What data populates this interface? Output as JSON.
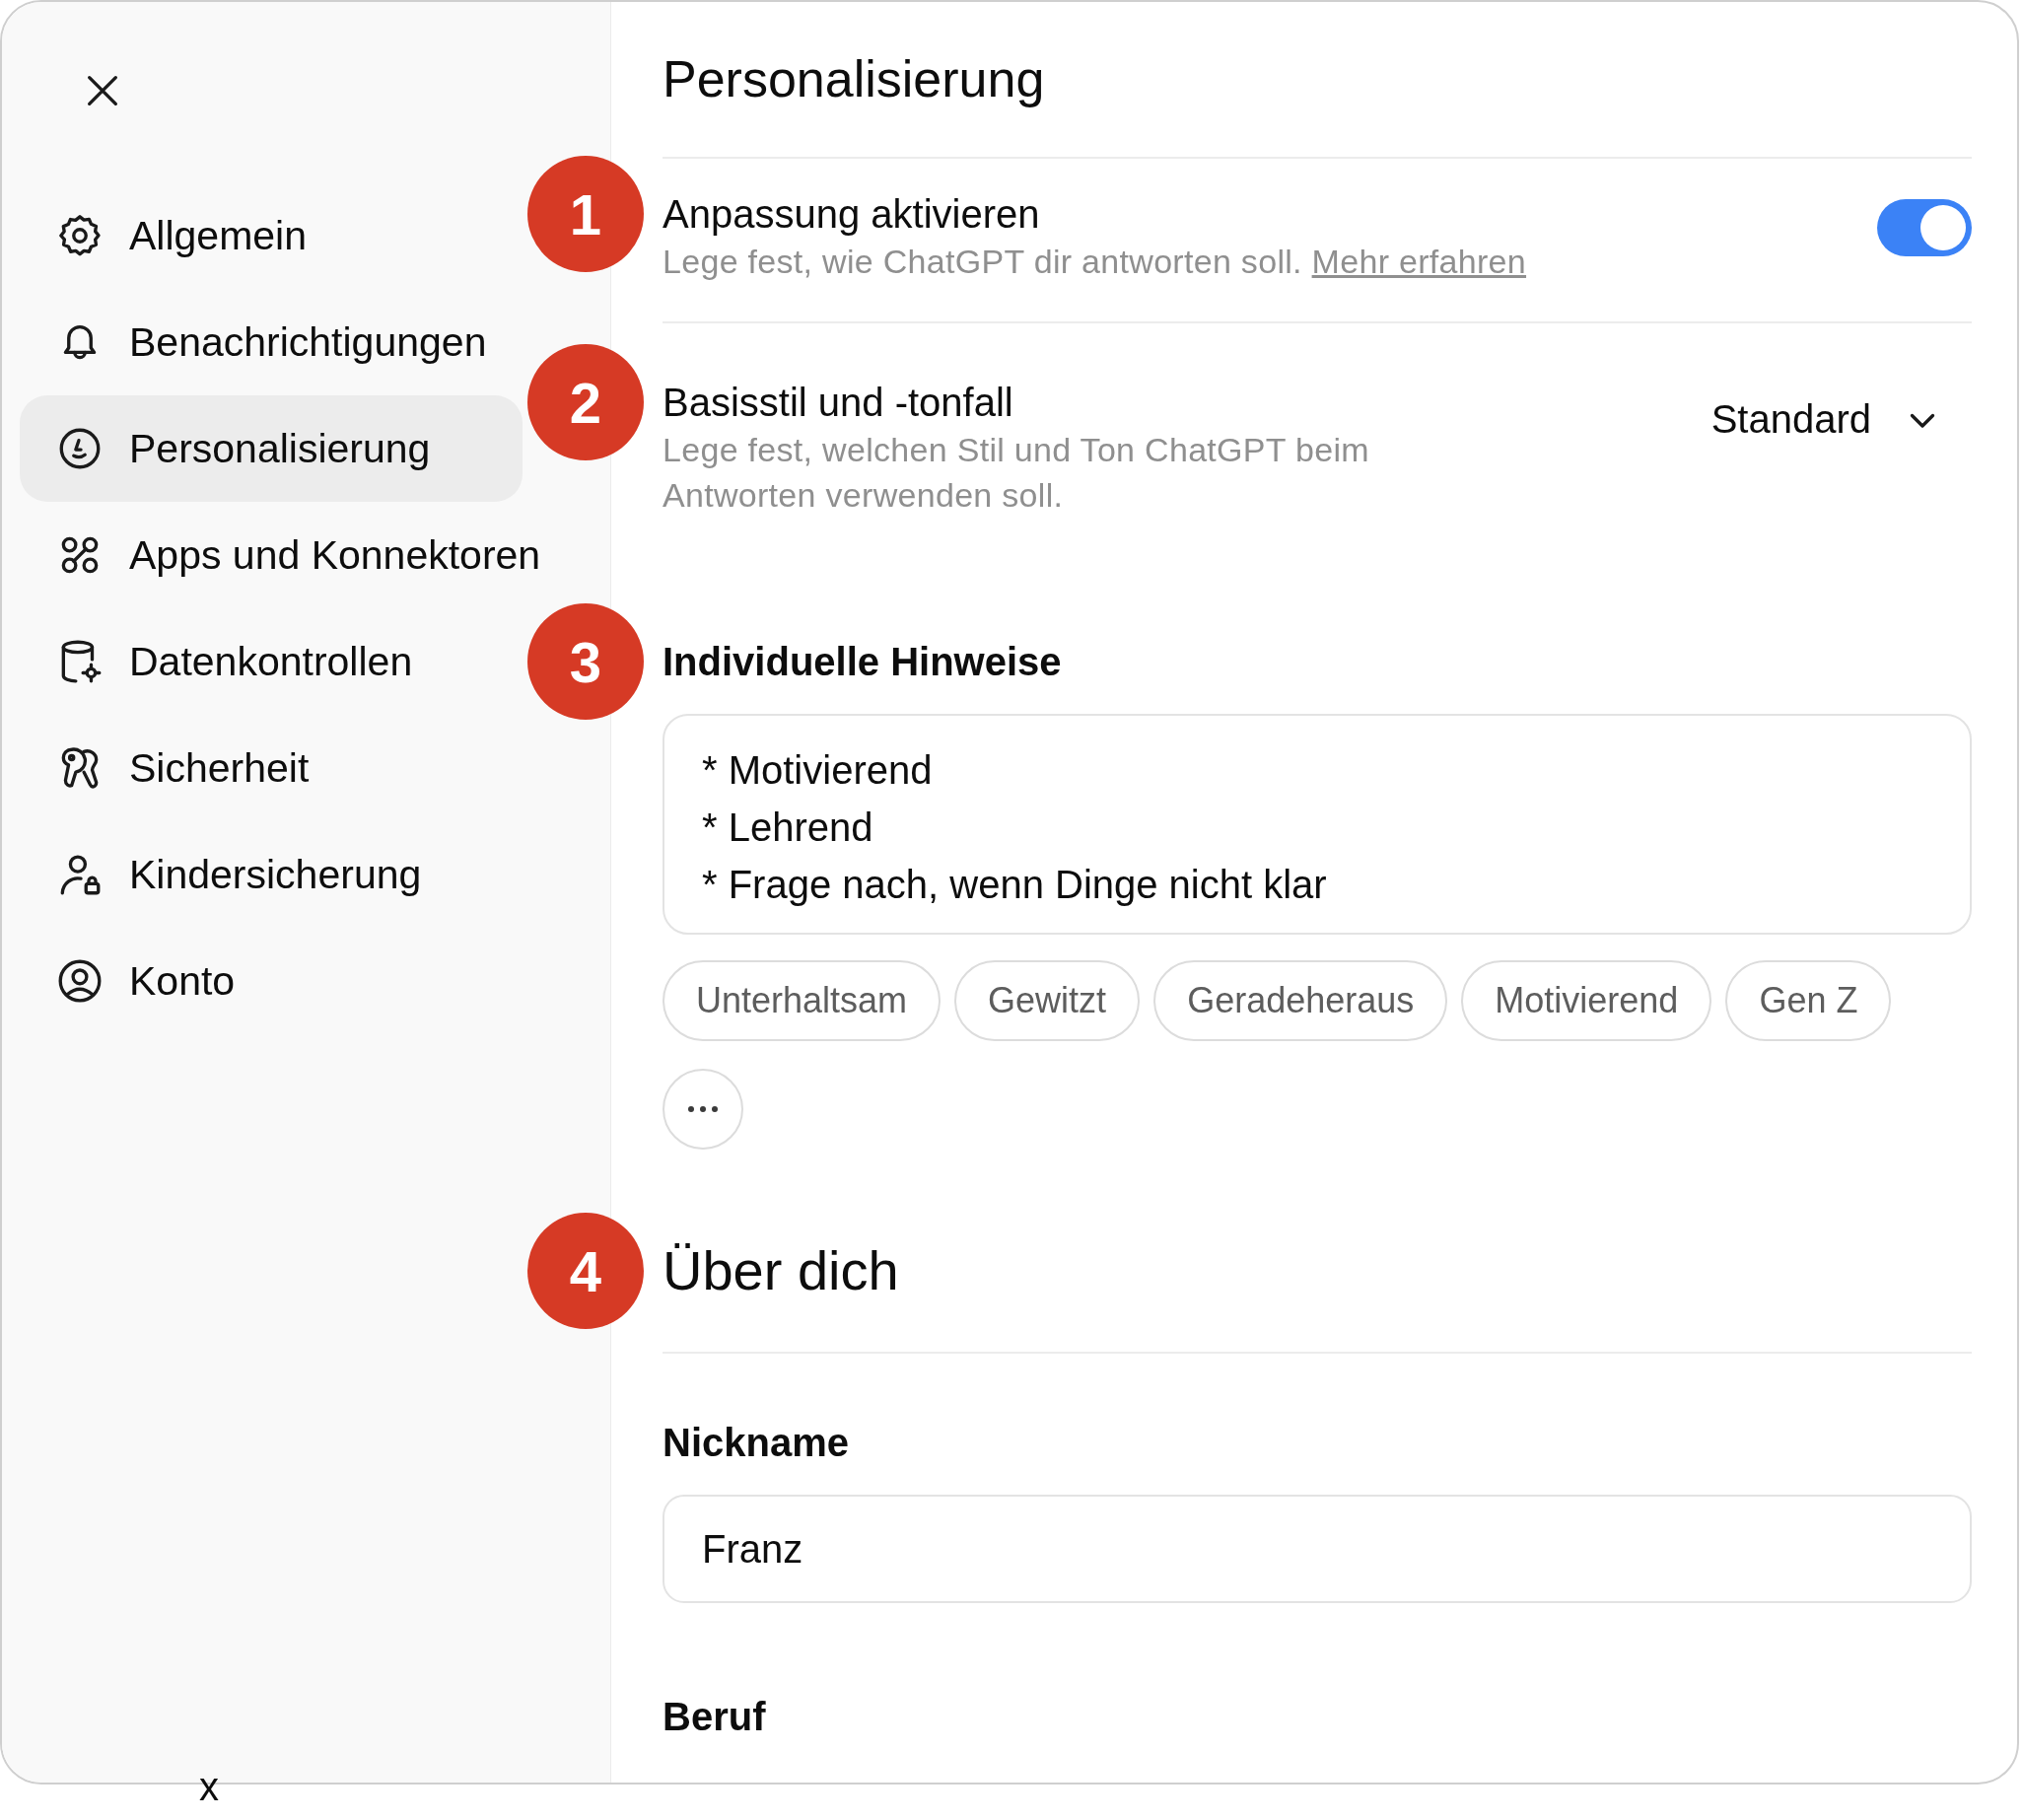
{
  "sidebar": {
    "items": [
      {
        "label": "Allgemein",
        "selected": false
      },
      {
        "label": "Benachrichtigungen",
        "selected": false
      },
      {
        "label": "Personalisierung",
        "selected": true
      },
      {
        "label": "Apps und Konnektoren",
        "selected": false
      },
      {
        "label": "Datenkontrollen",
        "selected": false
      },
      {
        "label": "Sicherheit",
        "selected": false
      },
      {
        "label": "Kindersicherung",
        "selected": false
      },
      {
        "label": "Konto",
        "selected": false
      }
    ]
  },
  "main": {
    "title": "Personalisierung",
    "customization": {
      "badge": "1",
      "title": "Anpassung aktivieren",
      "description": "Lege fest, wie ChatGPT dir antworten soll.",
      "link": "Mehr erfahren",
      "on": true
    },
    "base_style": {
      "badge": "2",
      "title": "Basisstil und -tonfall",
      "description": "Lege fest, welchen Stil und Ton ChatGPT beim Antworten verwenden soll.",
      "value": "Standard"
    },
    "instructions": {
      "badge": "3",
      "heading": "Individuelle Hinweise",
      "value": "* Motivierend\n* Lehrend\n* Frage nach, wenn Dinge nicht klar",
      "chips": [
        "Unterhaltsam",
        "Gewitzt",
        "Geradeheraus",
        "Motivierend",
        "Gen Z"
      ]
    },
    "about": {
      "badge": "4",
      "heading": "Über dich"
    },
    "nickname": {
      "label": "Nickname",
      "value": "Franz"
    },
    "occupation": {
      "label": "Beruf"
    }
  },
  "stray_mark": "x"
}
